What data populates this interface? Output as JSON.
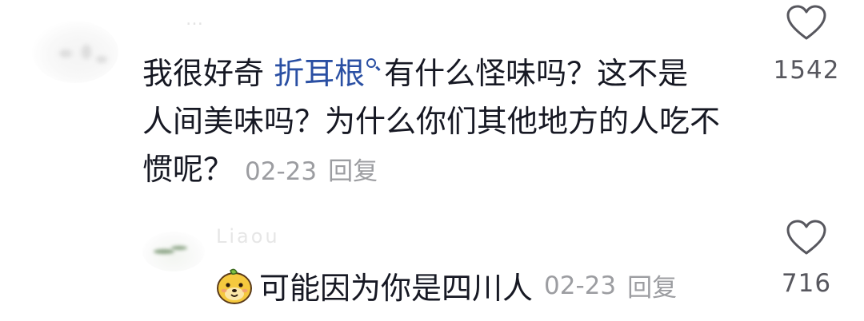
{
  "comments": [
    {
      "username": "…",
      "text_before_mention": "我很好奇 ",
      "mention": "折耳根",
      "text_line1_after": "有什么怪味吗？这不是",
      "text_line2": "人间美味吗？为什么你们其他地方的人吃不",
      "text_line3": "惯呢？",
      "date": "02-23",
      "reply_label": "回复",
      "like_count": "1542",
      "icons": {
        "like": "heart-outline-icon",
        "mention": "search-icon"
      }
    },
    {
      "username": "Liaou",
      "emoji": "dog-face-emoji",
      "text": "可能因为你是四川人",
      "date": "02-23",
      "reply_label": "回复",
      "like_count": "716",
      "icons": {
        "like": "heart-outline-icon"
      }
    }
  ],
  "colors": {
    "text": "#161823",
    "mention": "#2a4fa3",
    "meta": "#9c9da1",
    "like_count": "#57575e"
  }
}
